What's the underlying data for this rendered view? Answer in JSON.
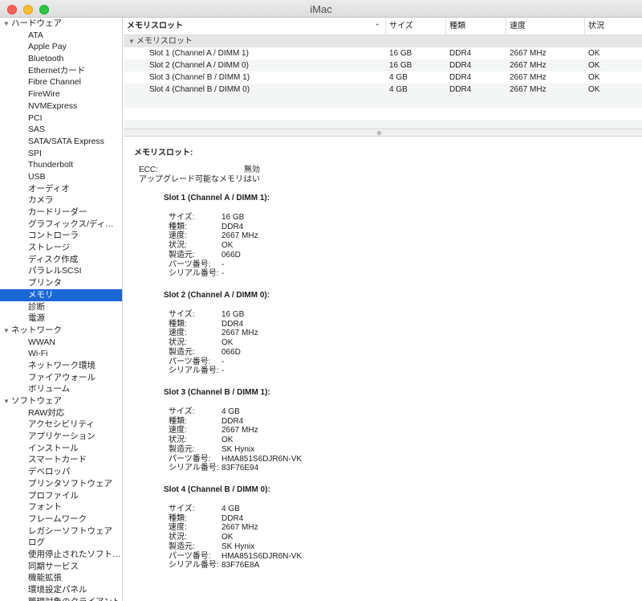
{
  "window": {
    "title": "iMac"
  },
  "sidebar": {
    "groups": [
      {
        "label": "ハードウェア",
        "items": [
          "ATA",
          "Apple Pay",
          "Bluetooth",
          "Ethernetカード",
          "Fibre Channel",
          "FireWire",
          "NVMExpress",
          "PCI",
          "SAS",
          "SATA/SATA Express",
          "SPI",
          "Thunderbolt",
          "USB",
          "オーディオ",
          "カメラ",
          "カードリーダー",
          "グラフィックス/ディス…",
          "コントローラ",
          "ストレージ",
          "ディスク作成",
          "パラレルSCSI",
          "プリンタ",
          "メモリ",
          "診断",
          "電源"
        ]
      },
      {
        "label": "ネットワーク",
        "items": [
          "WWAN",
          "Wi-Fi",
          "ネットワーク環境",
          "ファイアウォール",
          "ボリューム"
        ]
      },
      {
        "label": "ソフトウェア",
        "items": [
          "RAW対応",
          "アクセシビリティ",
          "アプリケーション",
          "インストール",
          "スマートカード",
          "デベロッパ",
          "プリンタソフトウェア",
          "プロファイル",
          "フォント",
          "フレームワーク",
          "レガシーソフトウェア",
          "ログ",
          "使用停止されたソフトウ…",
          "同期サービス",
          "機能拡張",
          "環境設定パネル",
          "管理対象のクライアント"
        ]
      }
    ],
    "selected": "メモリ"
  },
  "table": {
    "headers": {
      "name": "メモリスロット",
      "size": "サイズ",
      "type": "種類",
      "speed": "速度",
      "status": "状況"
    },
    "group_label": "メモリスロット",
    "rows": [
      {
        "name": "Slot 1 (Channel A / DIMM 1)",
        "size": "16 GB",
        "type": "DDR4",
        "speed": "2667 MHz",
        "status": "OK"
      },
      {
        "name": "Slot 2 (Channel A / DIMM 0)",
        "size": "16 GB",
        "type": "DDR4",
        "speed": "2667 MHz",
        "status": "OK"
      },
      {
        "name": "Slot 3 (Channel B / DIMM 1)",
        "size": "4 GB",
        "type": "DDR4",
        "speed": "2667 MHz",
        "status": "OK"
      },
      {
        "name": "Slot 4 (Channel B / DIMM 0)",
        "size": "4 GB",
        "type": "DDR4",
        "speed": "2667 MHz",
        "status": "OK"
      }
    ]
  },
  "detail": {
    "heading": "メモリスロット:",
    "summary": [
      {
        "key": "ECC:",
        "value": "無効"
      },
      {
        "key": "アップグレード可能なメモリ:",
        "value": "はい"
      }
    ],
    "slots": [
      {
        "title": "Slot 1 (Channel A / DIMM 1):",
        "fields": [
          {
            "key": "サイズ:",
            "value": "16 GB"
          },
          {
            "key": "種類:",
            "value": "DDR4"
          },
          {
            "key": "速度:",
            "value": "2667 MHz"
          },
          {
            "key": "状況:",
            "value": "OK"
          },
          {
            "key": "製造元:",
            "value": "066D"
          },
          {
            "key": "パーツ番号:",
            "value": "-"
          },
          {
            "key": "シリアル番号:",
            "value": "-"
          }
        ]
      },
      {
        "title": "Slot 2 (Channel A / DIMM 0):",
        "fields": [
          {
            "key": "サイズ:",
            "value": "16 GB"
          },
          {
            "key": "種類:",
            "value": "DDR4"
          },
          {
            "key": "速度:",
            "value": "2667 MHz"
          },
          {
            "key": "状況:",
            "value": "OK"
          },
          {
            "key": "製造元:",
            "value": "066D"
          },
          {
            "key": "パーツ番号:",
            "value": "-"
          },
          {
            "key": "シリアル番号:",
            "value": "-"
          }
        ]
      },
      {
        "title": "Slot 3 (Channel B / DIMM 1):",
        "fields": [
          {
            "key": "サイズ:",
            "value": "4 GB"
          },
          {
            "key": "種類:",
            "value": "DDR4"
          },
          {
            "key": "速度:",
            "value": "2667 MHz"
          },
          {
            "key": "状況:",
            "value": "OK"
          },
          {
            "key": "製造元:",
            "value": "SK Hynix"
          },
          {
            "key": "パーツ番号:",
            "value": "HMA851S6DJR6N-VK"
          },
          {
            "key": "シリアル番号:",
            "value": "83F76E94"
          }
        ]
      },
      {
        "title": "Slot 4 (Channel B / DIMM 0):",
        "fields": [
          {
            "key": "サイズ:",
            "value": "4 GB"
          },
          {
            "key": "種類:",
            "value": "DDR4"
          },
          {
            "key": "速度:",
            "value": "2667 MHz"
          },
          {
            "key": "状況:",
            "value": "OK"
          },
          {
            "key": "製造元:",
            "value": "SK Hynix"
          },
          {
            "key": "パーツ番号:",
            "value": "HMA851S6DJR6N-VK"
          },
          {
            "key": "シリアル番号:",
            "value": "83F76E8A"
          }
        ]
      }
    ]
  },
  "colors": {
    "selection": "#1b67d6",
    "alt_row": "#f4f5f5",
    "group_row": "#e6e6e6"
  }
}
